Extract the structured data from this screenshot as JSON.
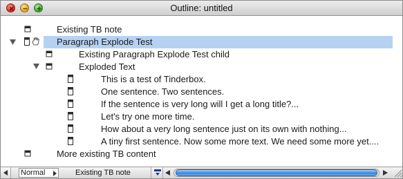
{
  "window": {
    "title": "Outline: untitled"
  },
  "outline": {
    "rows": [
      {
        "label": "Existing TB note",
        "kind": "note",
        "level": 0,
        "selected": false
      },
      {
        "label": "Paragraph Explode Test",
        "kind": "note-explode",
        "level": 0,
        "selected": true,
        "expanded": true
      },
      {
        "label": "Existing Paragraph Explode Test child",
        "kind": "note",
        "level": 1,
        "selected": false
      },
      {
        "label": "Exploded Text",
        "kind": "note",
        "level": 1,
        "selected": false,
        "expanded": true
      },
      {
        "label": "This is a test of Tinderbox.",
        "kind": "page",
        "level": 2
      },
      {
        "label": "One sentence. Two sentences.",
        "kind": "page",
        "level": 2
      },
      {
        "label": "If the sentence is very long will I get a long title?...",
        "kind": "page",
        "level": 2
      },
      {
        "label": "Let's try one more time.",
        "kind": "page",
        "level": 2
      },
      {
        "label": "How about a very long sentence just on its own with nothing...",
        "kind": "page",
        "level": 2
      },
      {
        "label": "A tiny first sentence. Now some more text. We need some more yet....",
        "kind": "page",
        "level": 2
      },
      {
        "label": "More existing TB content",
        "kind": "note",
        "level": 0,
        "selected": false
      }
    ]
  },
  "statusbar": {
    "mode": "Normal",
    "current_note": "Existing TB note"
  },
  "colors": {
    "selection": "#b6d2f3",
    "scroll_thumb": "#3b86e0"
  }
}
